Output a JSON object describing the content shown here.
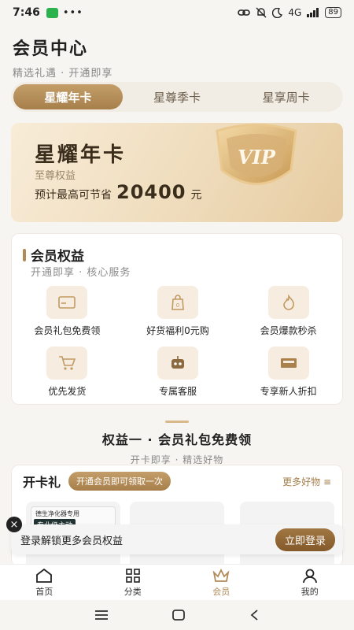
{
  "status": {
    "time": "7:46",
    "dots": "•••",
    "network": "4G",
    "battery": "89"
  },
  "header": {
    "title": "会员中心",
    "subtitle": "精选礼遇 · 开通即享"
  },
  "tabs": [
    {
      "label": "星耀年卡",
      "active": true
    },
    {
      "label": "星尊季卡",
      "active": false
    },
    {
      "label": "星享周卡",
      "active": false
    }
  ],
  "hero": {
    "title": "星耀年卡",
    "desc": "至尊权益",
    "save_prefix": "预计最高可节省",
    "amount": "20400",
    "unit": "元",
    "badge_text": "VIP"
  },
  "benefits": {
    "title": "会员权益",
    "subtitle": "开通即享 · 核心服务",
    "items": [
      {
        "label": "会员礼包免费领",
        "icon": "card-icon"
      },
      {
        "label": "好货福利0元购",
        "icon": "bag-icon"
      },
      {
        "label": "会员爆款秒杀",
        "icon": "fire-icon"
      },
      {
        "label": "优先发货",
        "icon": "cart-icon"
      },
      {
        "label": "专属客服",
        "icon": "robot-icon"
      },
      {
        "label": "专享新人折扣",
        "icon": "coupon-icon"
      }
    ]
  },
  "gift_section": {
    "title": "权益一 · 会员礼包免费领",
    "subtitle": "开卡即享 · 精选好物"
  },
  "card_panel": {
    "name": "开卡礼",
    "badge": "开通会员即可领取一次",
    "more": "更多好物 ≡",
    "product_text1": "德生净化器专用",
    "product_text2": "专业级主动"
  },
  "toast": {
    "text": "登录解锁更多会员权益",
    "button": "立即登录",
    "close": "×"
  },
  "navbar": [
    {
      "label": "首页",
      "icon": "home-icon",
      "active": false
    },
    {
      "label": "分类",
      "icon": "grid-icon",
      "active": false
    },
    {
      "label": "会员",
      "icon": "crown-icon",
      "active": true
    },
    {
      "label": "我的",
      "icon": "user-icon",
      "active": false
    }
  ],
  "colors": {
    "accent": "#b08a57",
    "accent_dark": "#845a2b",
    "hero_bg": "#efdcbc"
  }
}
